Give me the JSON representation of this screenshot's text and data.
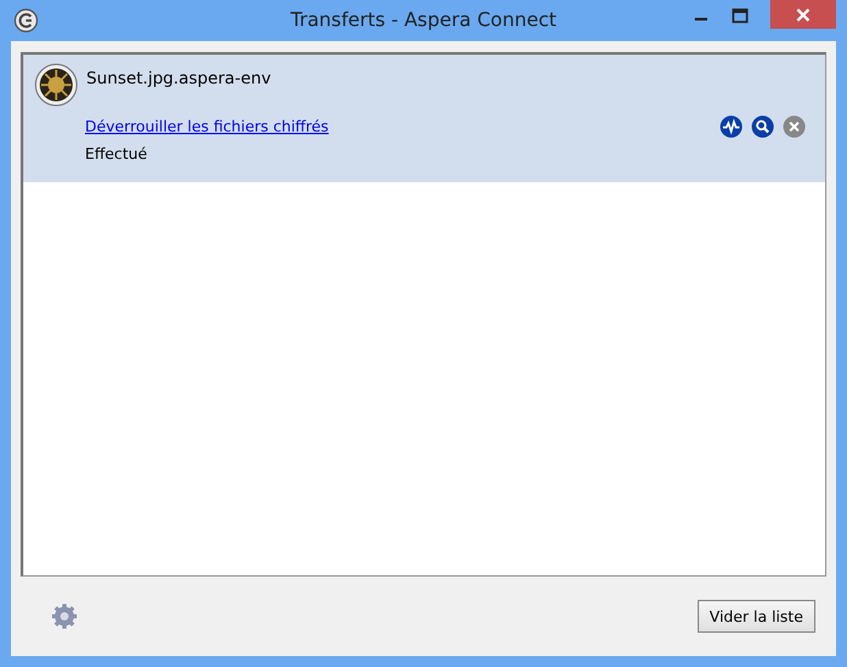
{
  "window": {
    "title": "Transferts - Aspera Connect"
  },
  "transfers": [
    {
      "name": "Sunset.jpg.aspera-env",
      "link": "Déverrouiller les fichiers chiffrés",
      "status": "Effectué",
      "selected": true
    }
  ],
  "footer": {
    "button": "Vider la liste"
  }
}
